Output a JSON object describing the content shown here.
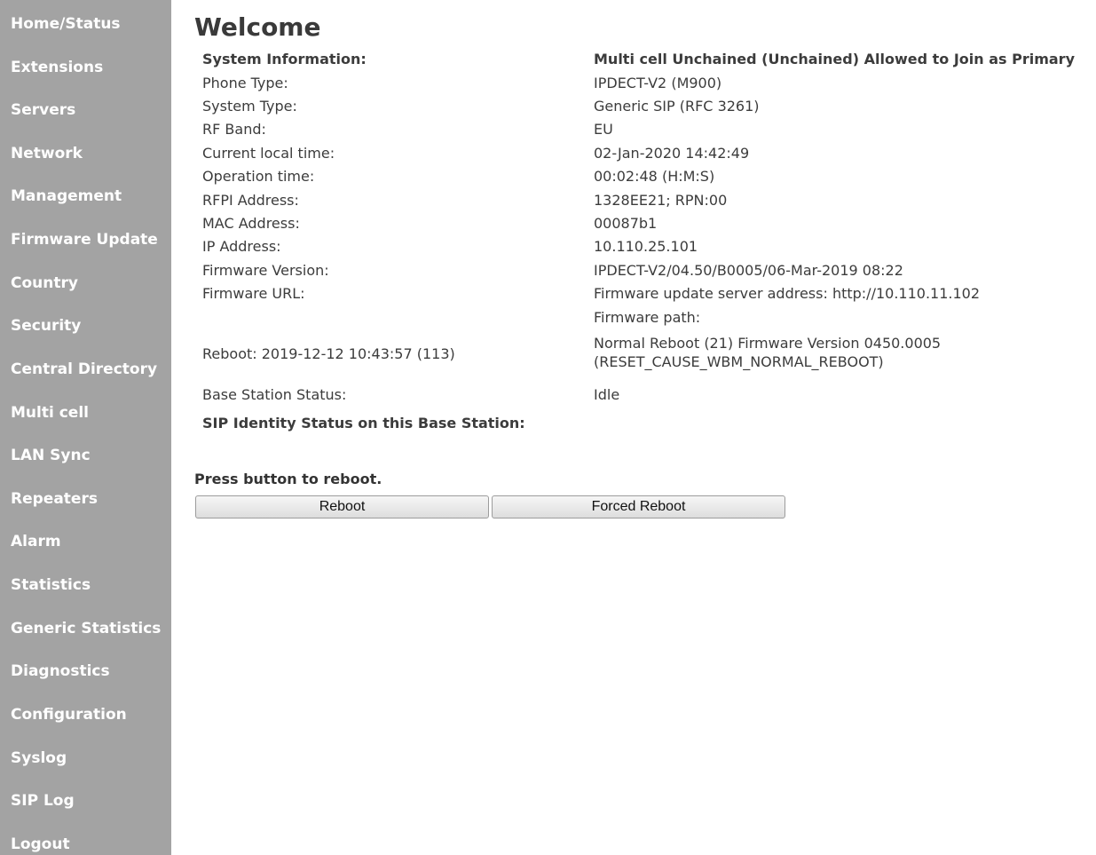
{
  "sidebar": {
    "items": [
      {
        "label": "Home/Status"
      },
      {
        "label": "Extensions"
      },
      {
        "label": "Servers"
      },
      {
        "label": "Network"
      },
      {
        "label": "Management"
      },
      {
        "label": "Firmware Update"
      },
      {
        "label": "Country"
      },
      {
        "label": "Security"
      },
      {
        "label": "Central Directory"
      },
      {
        "label": "Multi cell"
      },
      {
        "label": "LAN Sync"
      },
      {
        "label": "Repeaters"
      },
      {
        "label": "Alarm"
      },
      {
        "label": "Statistics"
      },
      {
        "label": "Generic Statistics"
      },
      {
        "label": "Diagnostics"
      },
      {
        "label": "Configuration"
      },
      {
        "label": "Syslog"
      },
      {
        "label": "SIP Log"
      },
      {
        "label": "Logout"
      }
    ]
  },
  "main": {
    "title": "Welcome",
    "system_info_label": "System Information:",
    "system_info_value": "Multi cell Unchained (Unchained) Allowed to Join as Primary",
    "rows": [
      {
        "label": "Phone Type:",
        "value": "IPDECT-V2 (M900)"
      },
      {
        "label": "System Type:",
        "value": "Generic SIP (RFC 3261)"
      },
      {
        "label": "RF Band:",
        "value": "EU"
      },
      {
        "label": "Current local time:",
        "value": "02-Jan-2020 14:42:49"
      },
      {
        "label": "Operation time:",
        "value": "00:02:48 (H:M:S)"
      },
      {
        "label": "RFPI Address:",
        "value": "1328EE21; RPN:00"
      },
      {
        "label": "MAC Address:",
        "value": "00087b1"
      },
      {
        "label": "IP Address:",
        "value": "10.110.25.101"
      },
      {
        "label": "Firmware Version:",
        "value": "IPDECT-V2/04.50/B0005/06-Mar-2019 08:22"
      },
      {
        "label": "Firmware URL:",
        "value": "Firmware update server address: http://10.110.11.102"
      }
    ],
    "firmware_path": "Firmware path:",
    "reboot_label": "Reboot: 2019-12-12 10:43:57 (113)",
    "reboot_value_line1": "Normal Reboot (21) Firmware Version 0450.0005",
    "reboot_value_line2": "(RESET_CAUSE_WBM_NORMAL_REBOOT)",
    "base_status_label": "Base Station Status:",
    "base_status_value": "Idle",
    "sip_identity_label": "SIP Identity Status on this Base Station:"
  },
  "reboot": {
    "heading": "Press button to reboot.",
    "reboot_button": "Reboot",
    "forced_reboot_button": "Forced Reboot"
  }
}
